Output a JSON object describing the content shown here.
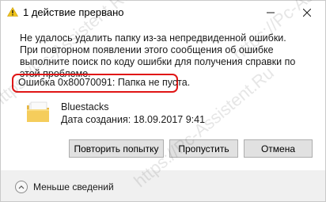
{
  "window": {
    "title": "1 действие прервано",
    "minimize_glyph": "—",
    "close_glyph": "✕"
  },
  "message": {
    "body": "Не удалось удалить папку из-за непредвиденной ошибки. При повторном появлении этого сообщения об ошибке выполните поиск по коду ошибки для получения справки по этой проблеме.",
    "error": "Ошибка 0x80070091: Папка не пуста."
  },
  "item": {
    "name": "Bluestacks",
    "date": "Дата создания: 18.09.2017 9:41",
    "icon": "folder-icon"
  },
  "buttons": {
    "retry": "Повторить попытку",
    "skip": "Пропустить",
    "cancel": "Отмена"
  },
  "footer": {
    "less_details": "Меньше сведений",
    "icon": "chevron-up-icon"
  },
  "watermark": "https://Pc-Assistent.Ru",
  "colors": {
    "highlight": "#e01616",
    "footer_bg": "#f0f0f0",
    "button_bg": "#e1e1e1"
  }
}
